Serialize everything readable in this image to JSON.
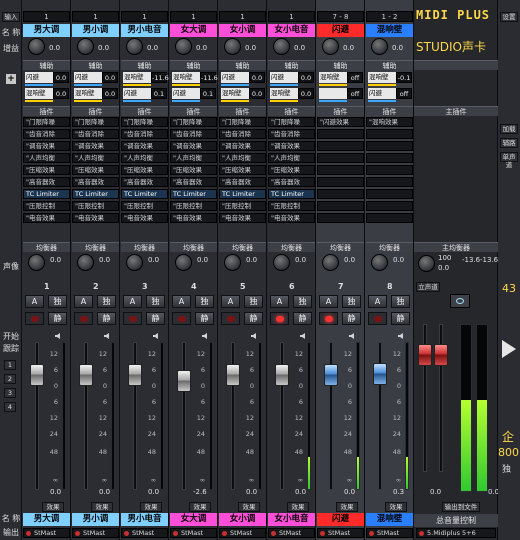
{
  "left_labels": {
    "input": "输入",
    "name": "名 称",
    "gain": "增益",
    "pan": "声像",
    "start": "开始",
    "follow": "跟踪",
    "name_bottom": "名 称",
    "output": "输出",
    "tracks": [
      "1",
      "2",
      "3",
      "4"
    ]
  },
  "section_labels": {
    "aux": "辅助",
    "plugins": "插件",
    "eq": "均衡器",
    "master_plugins": "主插件",
    "master_eq": "主均衡器",
    "master_vol": "总音量控制"
  },
  "brand": {
    "title": "MIDI PLUS",
    "subtitle": "STUDIO声卡",
    "settings": "设置"
  },
  "channels": [
    {
      "num": "1",
      "name": "男大调",
      "color": "#7fd0ff",
      "input": "1",
      "gain": "0.0",
      "pan": "0.0",
      "fader_db": "0.0",
      "knob": "0.0",
      "sends": [
        {
          "name": "闪避",
          "val": "0.0",
          "c": "#3da8ff"
        },
        {
          "name": "混响壁",
          "val": "0.0",
          "c": "#ffd000"
        }
      ],
      "plugins": [
        "\"门限降噪",
        "\"齿音消除",
        "\"调音效果",
        "\"人声均衡",
        "\"压缩效果",
        "\"高音器效",
        "TC Limiter",
        "\"压限控制",
        "\"电音效果"
      ],
      "rec_on": false,
      "fader_style": "white",
      "output": "StMast",
      "meter": 0
    },
    {
      "num": "2",
      "name": "男小调",
      "color": "#7fd0ff",
      "input": "1",
      "gain": "0.0",
      "pan": "0.0",
      "fader_db": "0.0",
      "knob": "0.0",
      "sends": [
        {
          "name": "闪避",
          "val": "0.0",
          "c": "#3da8ff"
        },
        {
          "name": "混响壁",
          "val": "0.0",
          "c": "#ffd000"
        }
      ],
      "plugins": [
        "\"门限降噪",
        "\"齿音消除",
        "\"调音效果",
        "\"人声均衡",
        "\"压缩效果",
        "\"高音器效",
        "TC Limiter",
        "\"压限控制",
        "\"电音效果"
      ],
      "rec_on": false,
      "fader_style": "white",
      "output": "StMast",
      "meter": 0
    },
    {
      "num": "3",
      "name": "男小电音",
      "color": "#7fd0ff",
      "input": "1",
      "gain": "0.0",
      "pan": "0.0",
      "fader_db": "0.0",
      "knob": "0.0",
      "sends": [
        {
          "name": "混响壁",
          "val": "-11.6",
          "c": "#ffd000"
        },
        {
          "name": "闪避",
          "val": "0.1",
          "c": "#3da8ff"
        }
      ],
      "plugins": [
        "\"门限降噪",
        "\"齿音消除",
        "\"调音效果",
        "\"人声均衡",
        "\"压缩效果",
        "\"高音器效",
        "TC Limiter",
        "\"压限控制",
        "\"电音效果"
      ],
      "rec_on": false,
      "fader_style": "white",
      "output": "StMast",
      "meter": 0
    },
    {
      "num": "4",
      "name": "女大调",
      "color": "#ff4fd8",
      "input": "1",
      "gain": "0.0",
      "pan": "0.0",
      "fader_db": "-2.6",
      "knob": "0.0",
      "sends": [
        {
          "name": "混响壁",
          "val": "-11.6",
          "c": "#ffd000"
        },
        {
          "name": "闪避",
          "val": "0.1",
          "c": "#3da8ff"
        }
      ],
      "plugins": [
        "\"门限降噪",
        "\"齿音消除",
        "\"调音效果",
        "\"人声均衡",
        "\"压缩效果",
        "\"高音器效",
        "TC Limiter",
        "\"压限控制",
        "\"电音效果"
      ],
      "rec_on": false,
      "fader_style": "white",
      "output": "StMast",
      "meter": 0
    },
    {
      "num": "5",
      "name": "女小调",
      "color": "#ff4fd8",
      "input": "1",
      "gain": "0.0",
      "pan": "0.0",
      "fader_db": "0.0",
      "knob": "0.0",
      "sends": [
        {
          "name": "闪避",
          "val": "0.0",
          "c": "#3da8ff"
        },
        {
          "name": "混响壁",
          "val": "0.0",
          "c": "#ffd000"
        }
      ],
      "plugins": [
        "\"门限降噪",
        "\"齿音消除",
        "\"调音效果",
        "\"人声均衡",
        "\"压缩效果",
        "\"高音器效",
        "TC Limiter",
        "\"压限控制",
        "\"电音效果"
      ],
      "rec_on": false,
      "fader_style": "white",
      "output": "StMast",
      "meter": 0
    },
    {
      "num": "6",
      "name": "女小电音",
      "color": "#ff4fd8",
      "input": "1",
      "gain": "0.0",
      "pan": "0.0",
      "fader_db": "0.0",
      "knob": "0.0",
      "sends": [
        {
          "name": "闪避",
          "val": "0.0",
          "c": "#3da8ff"
        },
        {
          "name": "混响壁",
          "val": "0.0",
          "c": "#ffd000"
        }
      ],
      "plugins": [
        "\"门限降噪",
        "\"齿音消除",
        "\"调音效果",
        "\"人声均衡",
        "\"压缩效果",
        "\"高音器效",
        "TC Limiter",
        "\"压限控制",
        "\"电音效果"
      ],
      "rec_on": true,
      "fader_style": "white",
      "output": "StMast",
      "meter": 0.22
    },
    {
      "num": "7",
      "name": "闪避",
      "color": "#ff2a2a",
      "input": "7 - 8",
      "gain": "0.0",
      "pan": "0.0",
      "fader_db": "0.0",
      "knob": "0.0",
      "sends": [
        {
          "name": "混响壁",
          "val": "off",
          "c": "#ffd000"
        },
        {
          "name": "",
          "val": "off",
          "c": "#3da8ff"
        }
      ],
      "plugins": [
        "\"闪避效果"
      ],
      "rec_on": true,
      "fader_style": "blue",
      "output": "StMast",
      "meter": 0.22
    },
    {
      "num": "8",
      "name": "混响壁",
      "color": "#2a7fff",
      "input": "1 - 2",
      "gain": "0.0",
      "pan": "0.0",
      "fader_db": "0.3",
      "knob": "0.0",
      "sends": [
        {
          "name": "混响壁",
          "val": "-0.1",
          "c": "#ffd000"
        },
        {
          "name": "闪避",
          "val": "off",
          "c": "#3da8ff"
        }
      ],
      "plugins": [
        "\"混响效果"
      ],
      "rec_on": false,
      "fader_style": "blue",
      "output": "StMast",
      "meter": 0.22
    }
  ],
  "fx_button": "效果",
  "solo": "独",
  "mute": "静",
  "a_btn": "A",
  "scale": [
    "12",
    "6",
    "0",
    "6",
    "12",
    "24",
    "48",
    "∞"
  ],
  "master": {
    "gain": "100",
    "pan": "0.0",
    "peak_l": "-13.6",
    "peak_r": "-13.6",
    "ch_label": "立声道",
    "eq_label": "主均衡器",
    "fader_db": "0.0",
    "db_right": "0.0",
    "output_label": "输出到文件",
    "output": "5.Midiplus 5+6",
    "meter_l": 0.55,
    "meter_r": 0.55
  },
  "right_panel": {
    "labels": [
      "设置",
      "加载",
      "辅路",
      "单声道"
    ],
    "number": "43",
    "brand_char": "企",
    "freq": "800",
    "mode": "独"
  }
}
